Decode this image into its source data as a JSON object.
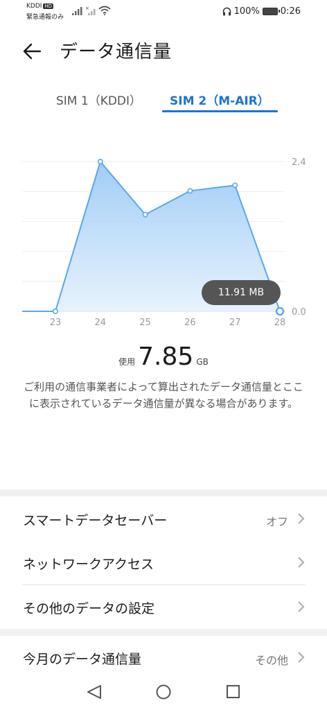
{
  "status_bar": {
    "carrier_top": "KDDI",
    "hd_badge": "HD",
    "carrier_bottom": "緊急通報のみ",
    "battery_percent": "100%",
    "time": "0:26"
  },
  "header": {
    "title": "データ通信量"
  },
  "tabs": [
    {
      "label": "SIM 1（KDDI）",
      "selected": false
    },
    {
      "label": "SIM 2（M-AIR）",
      "selected": true
    }
  ],
  "chart_data": {
    "type": "area",
    "x": [
      "23",
      "24",
      "25",
      "26",
      "27",
      "28"
    ],
    "values": [
      0.0,
      2.4,
      1.55,
      1.93,
      2.02,
      0.0
    ],
    "y_ticks": [
      "2.4",
      "0.0"
    ],
    "ylim": [
      0,
      2.4
    ],
    "tooltip": "11.91 MB",
    "color": "#5aa6ec"
  },
  "usage": {
    "label": "使用",
    "value": "7.85",
    "unit": "GB"
  },
  "note": "ご利用の通信事業者によって算出されたデータ通信量とここに表示されているデータ通信量が異なる場合があります。",
  "settings": {
    "smart_saver": {
      "label": "スマートデータセーバー",
      "value": "オフ"
    },
    "network_access": {
      "label": "ネットワークアクセス"
    },
    "other_settings": {
      "label": "その他のデータの設定"
    },
    "monthly": {
      "label": "今月のデータ通信量",
      "value": "その他"
    }
  },
  "colors": {
    "accent": "#1a73d9"
  }
}
